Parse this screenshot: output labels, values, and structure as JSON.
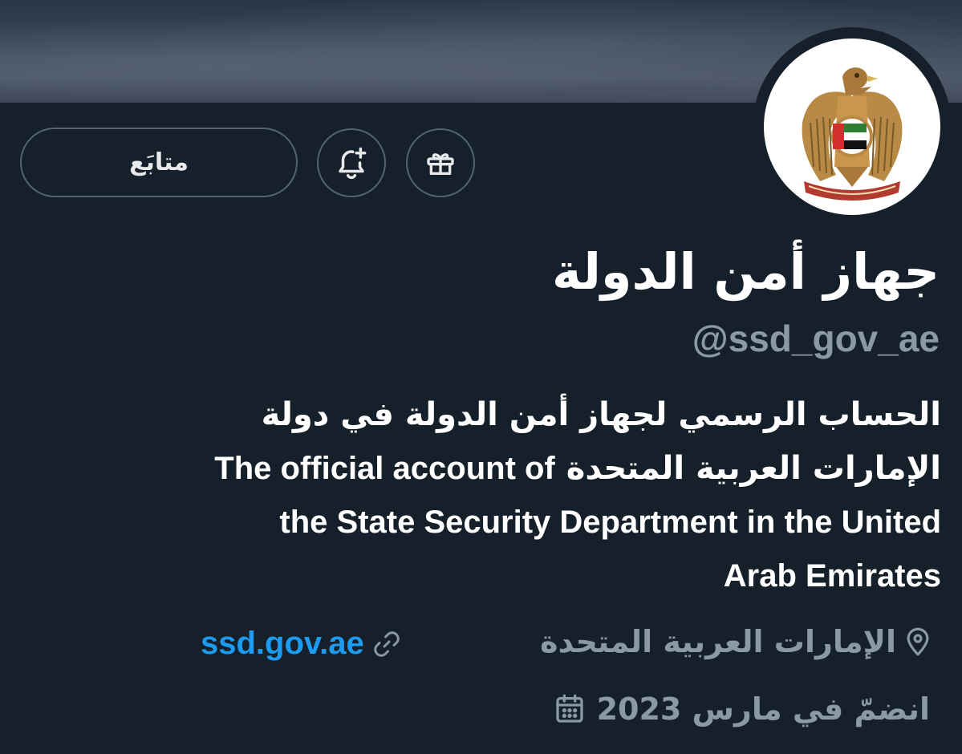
{
  "profile": {
    "display_name": "جهاز أمن الدولة",
    "handle": "@ssd_gov_ae",
    "avatar_emblem_text": "الإمارات العربية المتحدة"
  },
  "actions": {
    "follow_label": "متابَع",
    "gift_icon": "gift-icon",
    "notify_icon": "bell-plus-icon"
  },
  "bio": {
    "lines": [
      "الحساب الرسمي لجهاز أمن الدولة في دولة",
      "الإمارات العربية المتحدة",
      "The official account of",
      "the State Security Department in the United",
      "Arab Emirates"
    ]
  },
  "meta": {
    "location": "الإمارات العربية المتحدة",
    "location_icon": "location-pin-icon",
    "website": "ssd.gov.ae",
    "website_icon": "link-icon",
    "joined": "انضمّ في مارس 2023",
    "joined_icon": "calendar-icon"
  },
  "colors": {
    "background": "#15202b",
    "secondary_text": "#8b98a5",
    "link": "#1d9bf0",
    "border": "#536471"
  }
}
